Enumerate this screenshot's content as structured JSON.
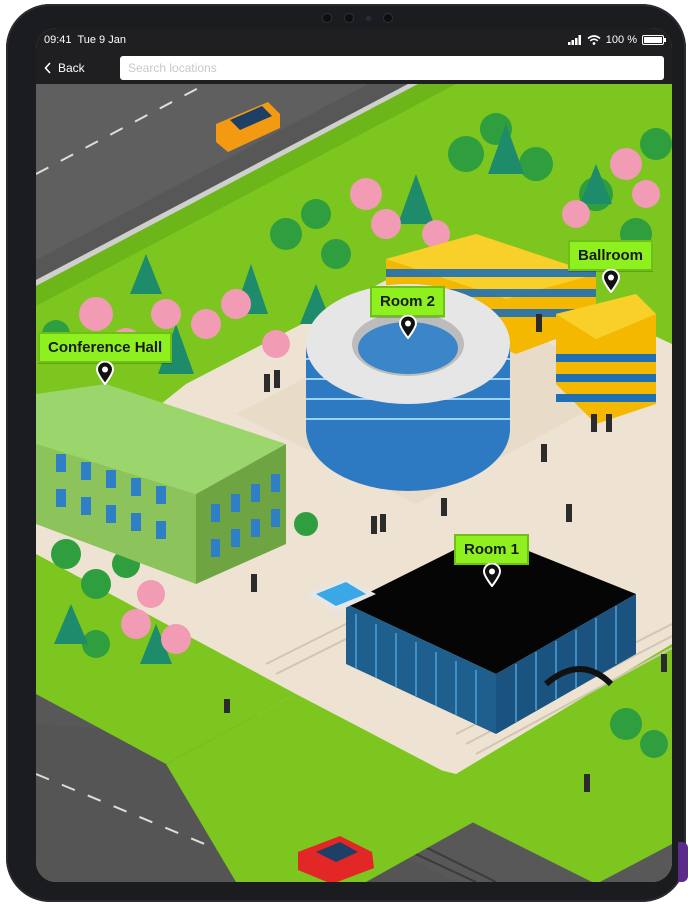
{
  "status_bar": {
    "time": "09:41",
    "date": "Tue 9 Jan",
    "battery": "100 %",
    "battery_level": 1.0
  },
  "nav": {
    "back_label": "Back",
    "search_placeholder": "Search locations"
  },
  "locations": [
    {
      "id": "conference-hall",
      "label": "Conference Hall"
    },
    {
      "id": "room-2",
      "label": "Room 2"
    },
    {
      "id": "ballroom",
      "label": "Ballroom"
    },
    {
      "id": "room-1",
      "label": "Room 1"
    }
  ],
  "colors": {
    "grass": "#7cc61f",
    "label_bg": "#8ef01f",
    "road": "#565656",
    "plaza": "#efe6d6"
  }
}
